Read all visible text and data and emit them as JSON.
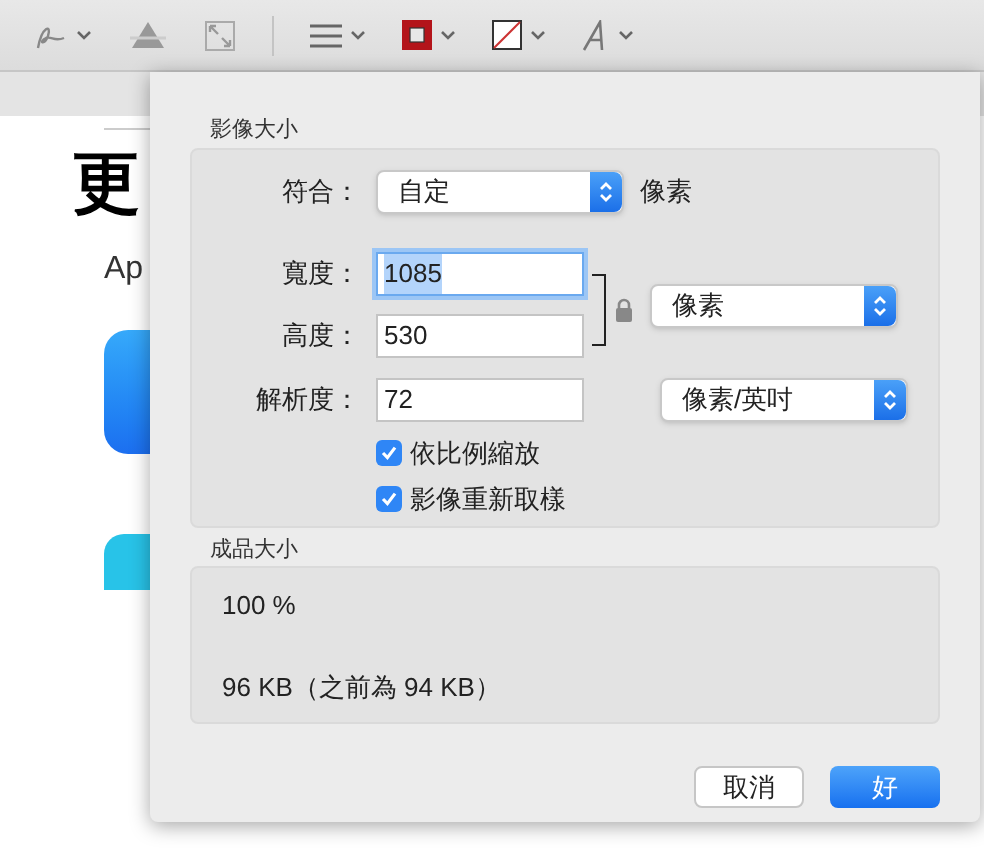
{
  "document": {
    "heading": "更",
    "text": "Ap"
  },
  "dialog": {
    "image_size": {
      "title": "影像大小",
      "fit": {
        "label": "符合：",
        "value": "自定",
        "unit": "像素"
      },
      "width": {
        "label": "寬度：",
        "value": "1085",
        "selected": true
      },
      "height": {
        "label": "高度：",
        "value": "530",
        "selected": false
      },
      "unit_popup": "像素",
      "resolution": {
        "label": "解析度：",
        "value": "72",
        "unit": "像素/英吋"
      },
      "checkboxes": [
        {
          "label": "依比例縮放",
          "checked": true
        },
        {
          "label": "影像重新取樣",
          "checked": true
        }
      ]
    },
    "result_size": {
      "title": "成品大小",
      "percent": "100 %",
      "size": "96 KB（之前為 94 KB）"
    },
    "buttons": [
      {
        "label": "取消",
        "default": false
      },
      {
        "label": "好",
        "default": true
      }
    ]
  }
}
